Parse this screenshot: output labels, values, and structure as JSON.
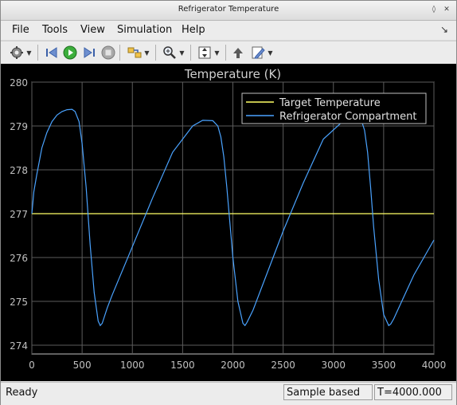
{
  "window": {
    "title": "Refrigerator Temperature"
  },
  "menu": {
    "file": "File",
    "tools": "Tools",
    "view": "View",
    "simulation": "Simulation",
    "help": "Help"
  },
  "toolbar": {
    "icons": [
      "settings-icon",
      "step-back-icon",
      "run-icon",
      "step-forward-icon",
      "stop-icon",
      "signal-select-icon",
      "zoom-icon",
      "scale-axes-icon",
      "highlight-block-icon",
      "edit-icon"
    ]
  },
  "status": {
    "state": "Ready",
    "mode": "Sample based",
    "time": "T=4000.000"
  },
  "colors": {
    "background": "#000000",
    "axes": "#c0c0c0",
    "target_line": "#ffff66",
    "compartment_line": "#4aa3ff",
    "title_text": "#d0d0d0"
  },
  "chart_data": {
    "type": "line",
    "title": "Temperature (K)",
    "xlabel": "",
    "ylabel": "",
    "xlim": [
      0,
      4000
    ],
    "ylim": [
      273.8,
      280
    ],
    "x_ticks": [
      0,
      500,
      1000,
      1500,
      2000,
      2500,
      3000,
      3500,
      4000
    ],
    "y_ticks": [
      274,
      275,
      276,
      277,
      278,
      279,
      280
    ],
    "grid": true,
    "legend_position": "top-right",
    "series": [
      {
        "name": "Target Temperature",
        "color": "#ffff66",
        "x": [
          0,
          4000
        ],
        "y": [
          277,
          277
        ]
      },
      {
        "name": "Refrigerator Compartment",
        "color": "#4aa3ff",
        "x": [
          0,
          20,
          50,
          100,
          150,
          200,
          250,
          300,
          350,
          400,
          430,
          470,
          500,
          540,
          580,
          620,
          660,
          680,
          700,
          750,
          800,
          1000,
          1200,
          1400,
          1600,
          1700,
          1800,
          1850,
          1880,
          1910,
          1940,
          1970,
          2000,
          2050,
          2100,
          2120,
          2140,
          2200,
          2300,
          2500,
          2700,
          2900,
          3100,
          3200,
          3280,
          3310,
          3340,
          3370,
          3400,
          3450,
          3500,
          3550,
          3570,
          3600,
          3700,
          3800,
          3900,
          4000
        ],
        "y": [
          277.0,
          277.5,
          277.9,
          278.5,
          278.85,
          279.1,
          279.25,
          279.33,
          279.37,
          279.38,
          279.33,
          279.1,
          278.6,
          277.6,
          276.3,
          275.2,
          274.55,
          274.45,
          274.5,
          274.85,
          275.15,
          276.25,
          277.35,
          278.4,
          279.0,
          279.13,
          279.12,
          279.0,
          278.75,
          278.3,
          277.6,
          276.8,
          276.0,
          275.0,
          274.5,
          274.45,
          274.52,
          274.8,
          275.4,
          276.6,
          277.7,
          278.7,
          279.12,
          279.15,
          279.12,
          278.9,
          278.4,
          277.6,
          276.7,
          275.5,
          274.7,
          274.45,
          274.48,
          274.6,
          275.1,
          275.6,
          276.0,
          276.4
        ]
      }
    ]
  }
}
